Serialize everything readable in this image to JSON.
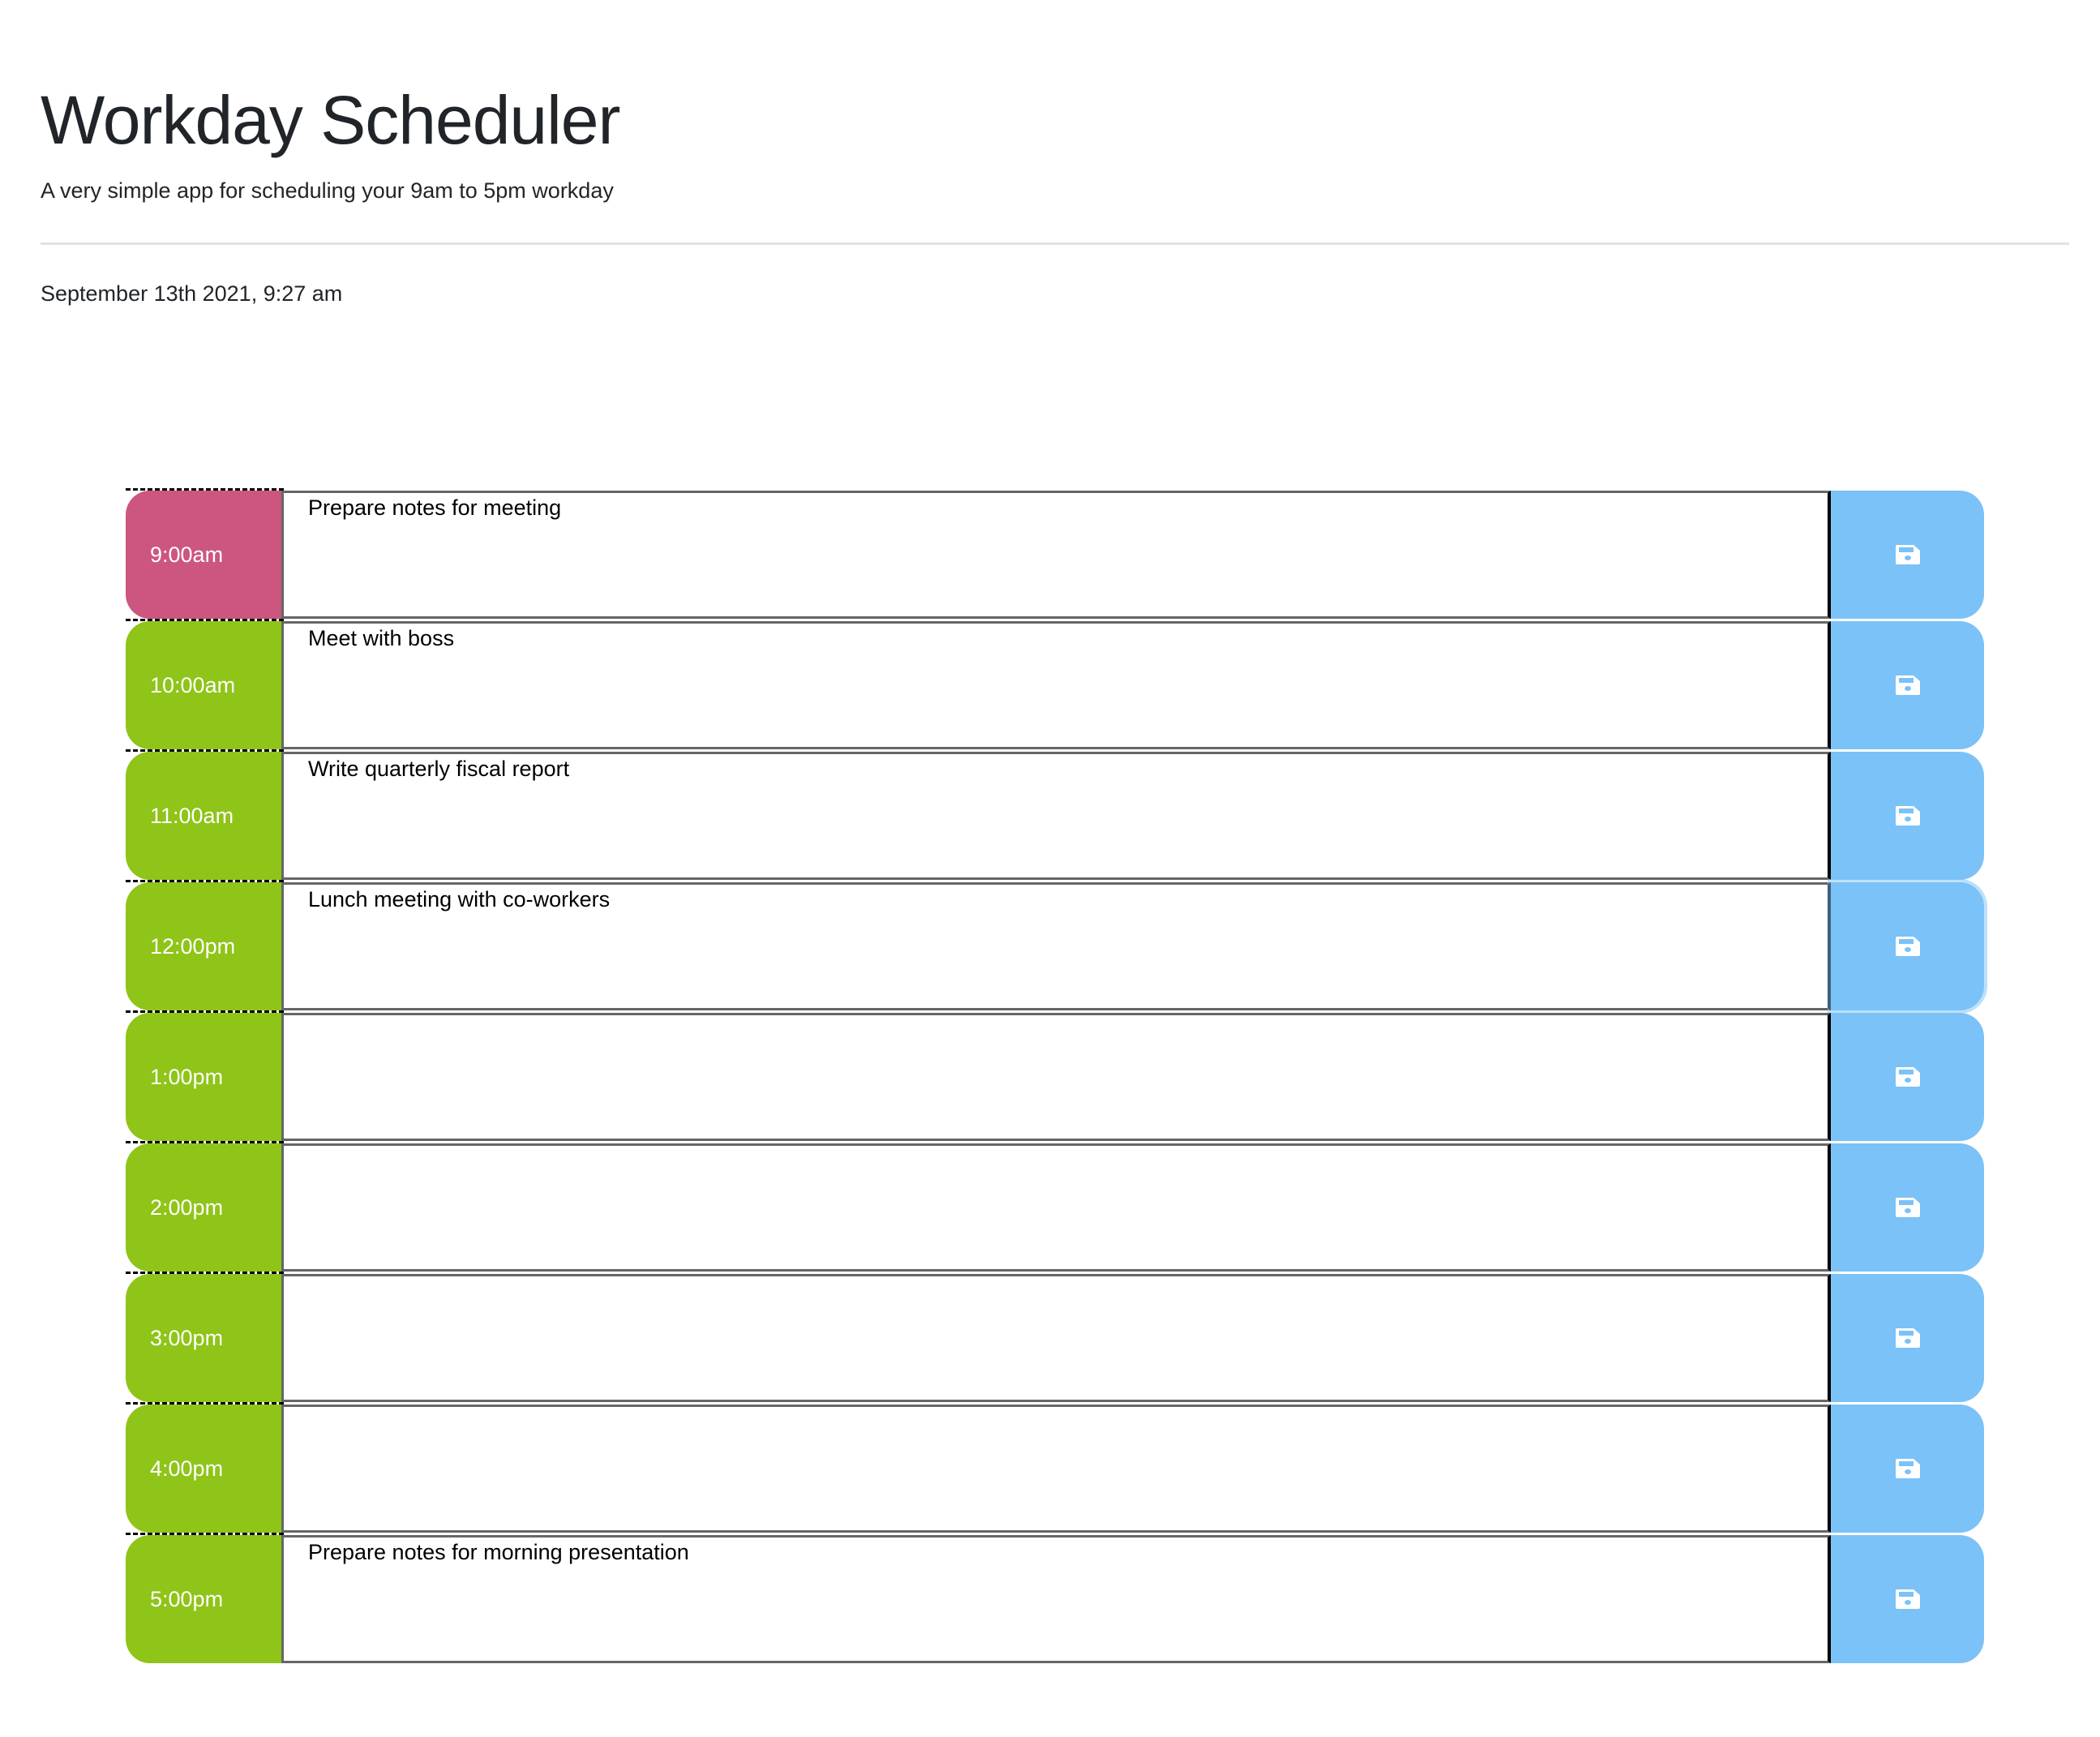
{
  "header": {
    "title": "Workday Scheduler",
    "subtitle": "A very simple app for scheduling your 9am to 5pm workday",
    "current_date": "September 13th 2021, 9:27 am"
  },
  "colors": {
    "past": "#cc5680",
    "future": "#8fc418",
    "save": "#7bc2f8"
  },
  "rows": [
    {
      "hour": "9:00am",
      "status": "past",
      "text": "Prepare notes for meeting"
    },
    {
      "hour": "10:00am",
      "status": "future",
      "text": "Meet with boss"
    },
    {
      "hour": "11:00am",
      "status": "future",
      "text": "Write quarterly fiscal report"
    },
    {
      "hour": "12:00pm",
      "status": "future",
      "text": "Lunch meeting with co-workers"
    },
    {
      "hour": "1:00pm",
      "status": "future",
      "text": ""
    },
    {
      "hour": "2:00pm",
      "status": "future",
      "text": ""
    },
    {
      "hour": "3:00pm",
      "status": "future",
      "text": ""
    },
    {
      "hour": "4:00pm",
      "status": "future",
      "text": ""
    },
    {
      "hour": "5:00pm",
      "status": "future",
      "text": "Prepare notes for morning presentation"
    }
  ],
  "save_icon": "floppy-disk-icon"
}
